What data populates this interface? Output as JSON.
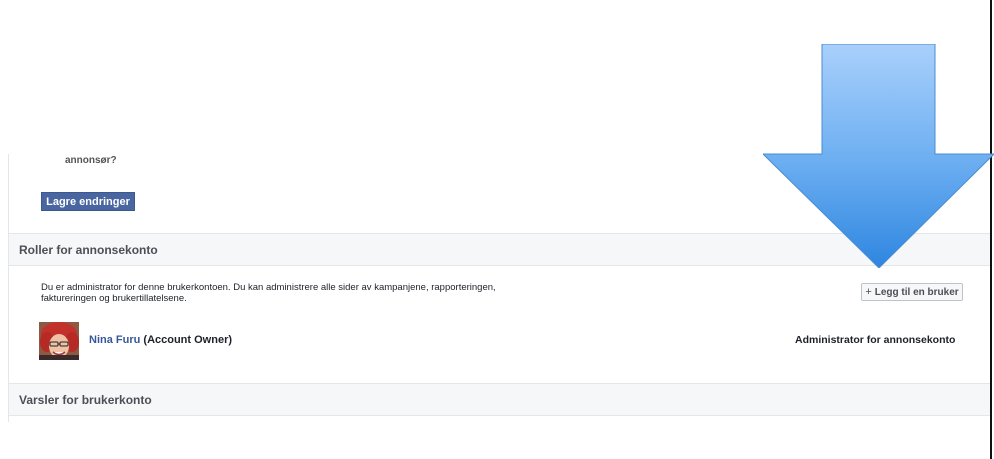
{
  "settings": {
    "question_tail": "annonsør?",
    "save_label": "Lagre endringer"
  },
  "roles_section": {
    "title": "Roller for annonsekonto",
    "description": "Du er administrator for denne brukerkontoen. Du kan administrere alle sider av kampanjene, rapporteringen, faktureringen og brukertillatelsene.",
    "add_user_icon": "+",
    "add_user_label": "Legg til en bruker",
    "user": {
      "name": "Nina Furu",
      "suffix": "(Account Owner)",
      "role": "Administrator for annonsekonto"
    }
  },
  "alerts_section": {
    "title": "Varsler for brukerkonto"
  },
  "annotation": {
    "arrow_color": "#3d92e6",
    "icon": "down-arrow-icon"
  }
}
